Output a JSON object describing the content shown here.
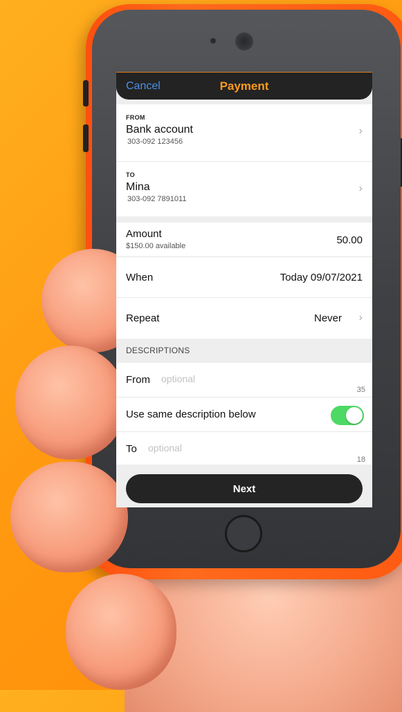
{
  "nav": {
    "cancel": "Cancel",
    "title": "Payment"
  },
  "from": {
    "label": "FROM",
    "name": "Bank account",
    "number": "303-092  123456"
  },
  "to": {
    "label": "TO",
    "name": "Mina",
    "number": "303-092  7891011"
  },
  "amount": {
    "label": "Amount",
    "available": "$150.00 available",
    "value": "50.00"
  },
  "when": {
    "label": "When",
    "value": "Today 09/07/2021"
  },
  "repeat": {
    "label": "Repeat",
    "value": "Never"
  },
  "descriptions": {
    "header": "DESCRIPTIONS",
    "from_label": "From",
    "from_placeholder": "optional",
    "from_counter": "35",
    "same_label": "Use same description below",
    "same_enabled": true,
    "to_label": "To",
    "to_placeholder": "optional",
    "to_counter": "18"
  },
  "next_button": "Next",
  "icons": {
    "chevron": "chevron-right-icon"
  },
  "colors": {
    "accent": "#ff9a1f",
    "link": "#4a90e2",
    "toggle_on": "#4cd964",
    "device": "#ff5a12"
  }
}
